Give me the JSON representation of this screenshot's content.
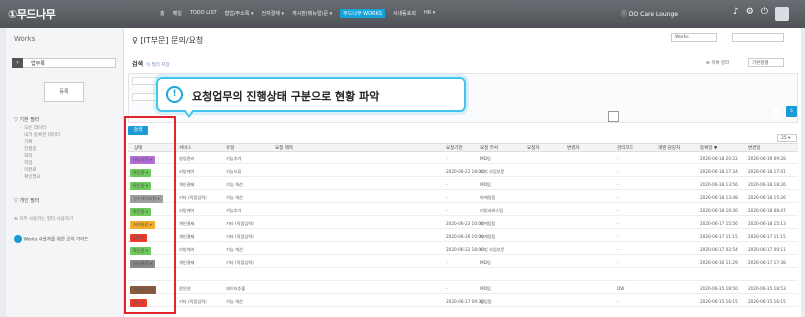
{
  "header": {
    "logo": "①무드나무",
    "nav": [
      "홈",
      "메일",
      "TODO LIST",
      "협업/주소록 ▾",
      "전자결재 ▾",
      "게시판(메뉴얼)문 ▾",
      "무드나무 WORKS",
      "사내동호회",
      "HR ▾"
    ],
    "active_nav": "무드나무 WORKS",
    "lounge": "Ⓘ DO Care Lounge",
    "icons": [
      "bell-icon",
      "gear-icon",
      "power-icon"
    ]
  },
  "sidebar": {
    "title": "Works",
    "select_value": "업무록",
    "register_label": "등록",
    "sections": [
      {
        "label": "▽ 기본 필터",
        "items": [
          "◦ 모든 데이터",
          "◦ 내가 등록한 데이터",
          "◦ 기록",
          "◦ 진행중",
          "◦ 처리",
          "◦ 작업",
          "◦ 미완료",
          "◦ 확인필요"
        ]
      },
      {
        "label": "▽ 개인 필터",
        "items": [
          "⊕ 자주 사용하는 필터 사용하기"
        ]
      }
    ],
    "footer_link": "Works 사용자를 위한 공지 가이드"
  },
  "main": {
    "page_title": "♀ [IT부문] 문의/요청",
    "works_select": "Works",
    "search_title": "검색",
    "search_link": "이 필터 저장",
    "sort_note": "⊕ 목록 정리",
    "sort_select": "기본정렬",
    "size_select": "25 ▾",
    "search_button": "검색"
  },
  "callout": {
    "number": "!",
    "text": "요청업무의 진행상태 구분으로 현황 파악"
  },
  "table": {
    "columns": [
      "상태",
      "서비스",
      "유형",
      "요청 제목",
      "요청기한",
      "요청 부서",
      "요청자",
      "변경자",
      "관리코드",
      "개발 담당자",
      "등록일 ▼",
      "변경일"
    ],
    "rows": [
      {
        "status": "대응대기 ▾",
        "color": "#b06ed6",
        "service": "영업관리",
        "type": "기능추가",
        "deadline": "-",
        "dept": "MD팀",
        "code": "-",
        "reg": "2020-06-18 20:22",
        "mod": "2020-06-19 09:28"
      },
      {
        "status": "확인중 ▾",
        "color": "#6ec85a",
        "service": "리빙케어",
        "type": "기능오류",
        "deadline": "2020-06-22 18:00",
        "dept": "리빙 사업부문",
        "code": "-",
        "reg": "2020-06-18 17:34",
        "mod": "2020-06-18 17:41"
      },
      {
        "status": "확인중 ▾",
        "color": "#6ec85a",
        "service": "개인결제",
        "type": "기능 개선",
        "deadline": "-",
        "dept": "MD팀",
        "code": "-",
        "reg": "2020-06-18 13:56",
        "mod": "2020-06-18 18:26"
      },
      {
        "status": "검수대기요청 ▾",
        "color": "#a0a0a0",
        "service": "기타 (직접입력)",
        "type": "기능 개선",
        "deadline": "-",
        "dept": "마케팅팀",
        "code": "-",
        "reg": "2020-06-18 13:48",
        "mod": "2020-06-18 15:26"
      },
      {
        "status": "확인중 ▾",
        "color": "#6ec85a",
        "service": "리빙케어",
        "type": "기능추가",
        "deadline": "-",
        "dept": "리빙서비스팀",
        "code": "-",
        "reg": "2020-06-18 10:30",
        "mod": "2020-06-18 08:47"
      },
      {
        "status": "처리완료 ▾",
        "color": "#f1ad2b",
        "service": "개인결제",
        "type": "기타 (직접입력)",
        "deadline": "2020-06-23 10:00",
        "dept": "마케팅팀",
        "code": "-",
        "reg": "2020-06-17 15:56",
        "mod": "2020-06-18 15:13"
      },
      {
        "status": "검수 ▾",
        "color": "#ea3a2c",
        "service": "개인결제",
        "type": "기타 (직접입력)",
        "deadline": "2020-06-26 10:00",
        "dept": "마케팅팀",
        "code": "-",
        "reg": "2020-06-17 11:15",
        "mod": "2020-06-17 11:15"
      },
      {
        "status": "확인중 ▾",
        "color": "#6ec85a",
        "service": "리빙케어",
        "type": "기능 개선",
        "deadline": "2020-06-22 18:00",
        "dept": "리빙 사업부문",
        "code": "-",
        "reg": "2020-06-17 02:54",
        "mod": "2020-06-17 09:11"
      },
      {
        "status": "처리완료 ▾",
        "color": "#888888",
        "service": "개인결제",
        "type": "기타 (직접입력)",
        "deadline": "-",
        "dept": "MD팀",
        "code": "-",
        "reg": "2020-06-16 11:29",
        "mod": "2020-06-17 17:38"
      },
      {
        "status": "",
        "color": "",
        "service": "",
        "type": "",
        "deadline": "",
        "dept": "",
        "code": "",
        "reg": "",
        "mod": ""
      },
      {
        "status": "개발 요청 ▾",
        "color": "#8a5a3c",
        "service": "장인넷",
        "type": "데이터추출",
        "deadline": "-",
        "dept": "MD팀",
        "code": "DW",
        "reg": "2020-06-15 18:50",
        "mod": "2020-06-15 18:53"
      },
      {
        "status": "검수 ▾",
        "color": "#ea3a2c",
        "service": "기타 (직접입력)",
        "type": "기능 개선",
        "deadline": "2020-06-17 09:30",
        "dept": "영업팀",
        "code": "-",
        "reg": "2020-06-15 16:15",
        "mod": "2020-06-15 16:15"
      }
    ]
  }
}
